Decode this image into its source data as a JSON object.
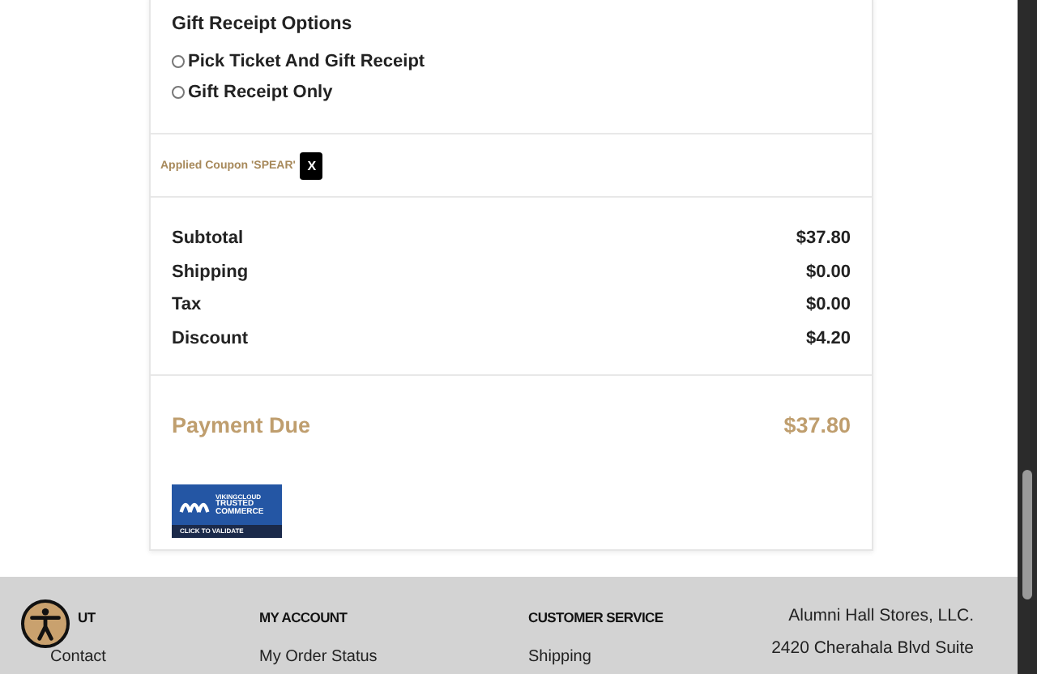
{
  "gift_receipt": {
    "title": "Gift Receipt Options",
    "options": [
      {
        "label": "Pick Ticket And Gift Receipt",
        "selected": false
      },
      {
        "label": "Gift Receipt Only",
        "selected": false
      }
    ]
  },
  "coupon": {
    "label": "Applied Coupon 'SPEAR'",
    "remove": "X"
  },
  "totals": [
    {
      "label": "Subtotal",
      "value": "$37.80"
    },
    {
      "label": "Shipping",
      "value": "$0.00"
    },
    {
      "label": "Tax",
      "value": "$0.00"
    },
    {
      "label": "Discount",
      "value": "$4.20"
    }
  ],
  "payment_due": {
    "label": "Payment Due",
    "value": "$37.80"
  },
  "trust_badge": {
    "brand": "VIKINGCLOUD",
    "line1": "TRUSTED",
    "line2": "COMMERCE",
    "action": "CLICK TO VALIDATE"
  },
  "footer": {
    "columns": [
      {
        "heading": "UT",
        "links": [
          "Contact"
        ]
      },
      {
        "heading": "MY ACCOUNT",
        "links": [
          "My Order Status"
        ]
      },
      {
        "heading": "CUSTOMER SERVICE",
        "links": [
          "Shipping"
        ]
      }
    ],
    "address": [
      "Alumni Hall Stores, LLC.",
      "2420 Cherahala Blvd Suite"
    ]
  }
}
